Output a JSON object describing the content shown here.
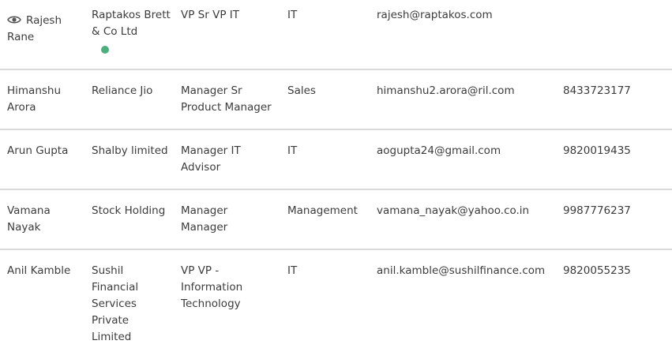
{
  "rows": [
    {
      "name": "Rajesh Rane",
      "company": "Raptakos Brett & Co Ltd",
      "designation": "VP Sr VP IT",
      "department": "IT",
      "email": "rajesh@raptakos.com",
      "phone": ""
    },
    {
      "name": "Himanshu Arora",
      "company": "Reliance Jio",
      "designation": "Manager Sr Product Manager",
      "department": "Sales",
      "email": "himanshu2.arora@ril.com",
      "phone": "8433723177"
    },
    {
      "name": "Arun Gupta",
      "company": "Shalby limited",
      "designation": "Manager IT Advisor",
      "department": "IT",
      "email": "aogupta24@gmail.com",
      "phone": "9820019435"
    },
    {
      "name": "Vamana Nayak",
      "company": "Stock Holding",
      "designation": "Manager Manager",
      "department": "Management",
      "email": "vamana_nayak@yahoo.co.in",
      "phone": "9987776237"
    },
    {
      "name": "Anil Kamble",
      "company": "Sushil Financial Services Private Limited",
      "designation": "VP VP - Information Technology",
      "department": "IT",
      "email": "anil.kamble@sushilfinance.com",
      "phone": "9820055235"
    }
  ],
  "icons": {
    "view": "eye-icon",
    "status": "online-status-dot"
  },
  "colors": {
    "status_dot": "#4caf7d",
    "divider": "#d9d9d9",
    "text": "#3c3c3c"
  }
}
